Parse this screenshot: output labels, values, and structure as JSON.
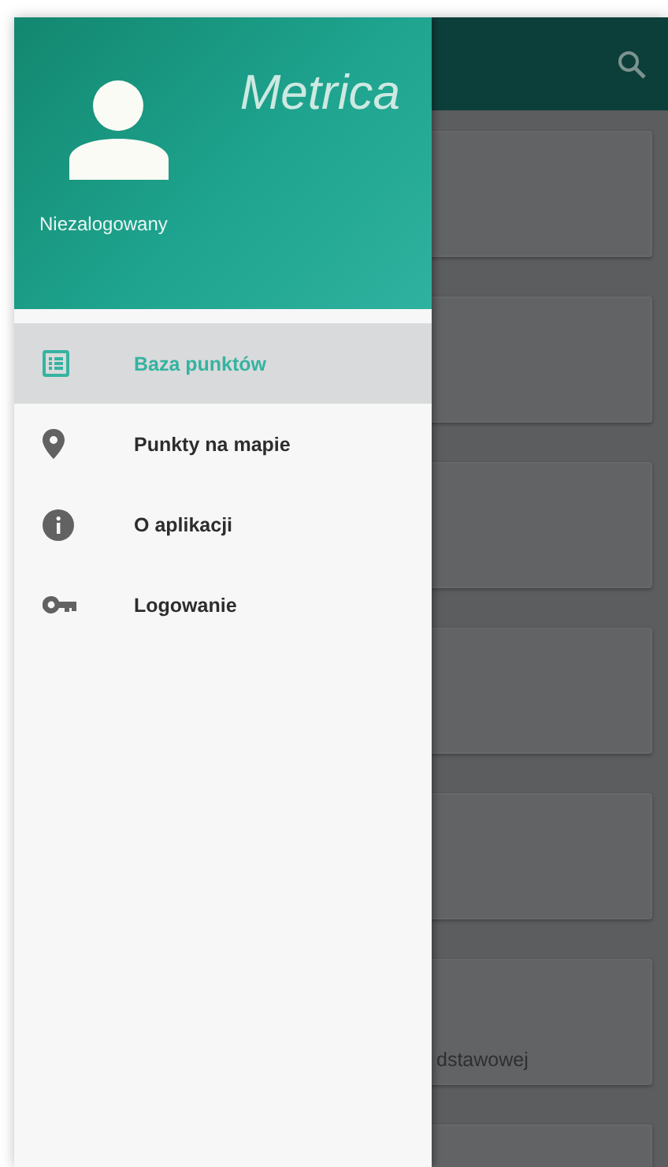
{
  "drawer": {
    "app_title": "Metrica",
    "user_status": "Niezalogowany",
    "items": [
      {
        "label": "Baza punktów",
        "kind": "list",
        "selected": true
      },
      {
        "label": "Punkty na mapie",
        "kind": "pin",
        "selected": false
      },
      {
        "label": "O aplikacji",
        "kind": "info",
        "selected": false
      },
      {
        "label": "Logowanie",
        "kind": "key",
        "selected": false
      }
    ]
  },
  "background": {
    "cards": [
      {
        "kind": "blank"
      },
      {
        "kind": "blank"
      },
      {
        "kind": "blank"
      },
      {
        "kind": "blank"
      },
      {
        "kind": "blank"
      },
      {
        "kind": "text",
        "text": "dstawowej"
      },
      {
        "kind": "blank"
      }
    ]
  }
}
